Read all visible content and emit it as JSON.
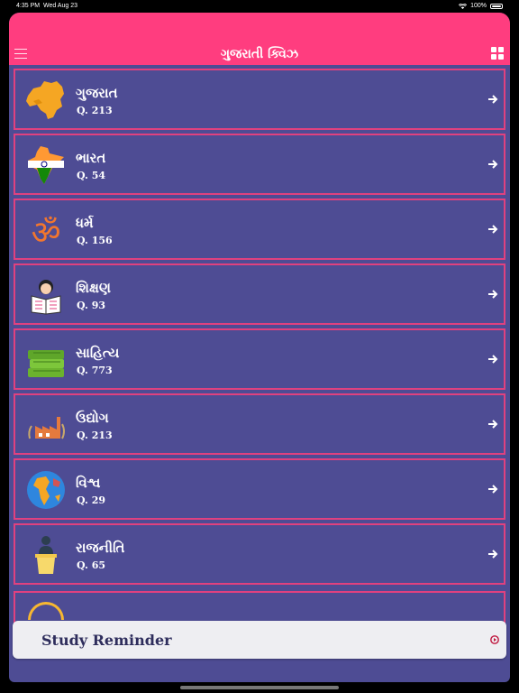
{
  "status_bar": {
    "time": "4:35 PM",
    "date": "Wed Aug 23",
    "battery": "100%"
  },
  "header": {
    "title": "ગુજરાતી ક્વિઝ",
    "menu_icon": "hamburger-icon",
    "grid_icon": "grid-icon"
  },
  "categories": [
    {
      "title": "ગુજરાત",
      "count": "Q. 213",
      "icon": "gujarat-map-icon"
    },
    {
      "title": "ભારત",
      "count": "Q. 54",
      "icon": "india-map-icon"
    },
    {
      "title": "ધર્મ",
      "count": "Q. 156",
      "icon": "om-icon"
    },
    {
      "title": "શિક્ષણ",
      "count": "Q. 93",
      "icon": "student-reading-icon"
    },
    {
      "title": "સાહિત્ય",
      "count": "Q. 773",
      "icon": "books-icon"
    },
    {
      "title": "ઉદ્યોગ",
      "count": "Q. 213",
      "icon": "factory-icon"
    },
    {
      "title": "વિશ્વ",
      "count": "Q. 29",
      "icon": "globe-icon"
    },
    {
      "title": "રાજનીતિ",
      "count": "Q. 65",
      "icon": "podium-speaker-icon"
    }
  ],
  "reminder": {
    "label": "Study Reminder"
  },
  "colors": {
    "header": "#FF3D7F",
    "background": "#4E4C94",
    "row_border": "#E0417F",
    "reminder_bg": "#EEEEF2"
  }
}
